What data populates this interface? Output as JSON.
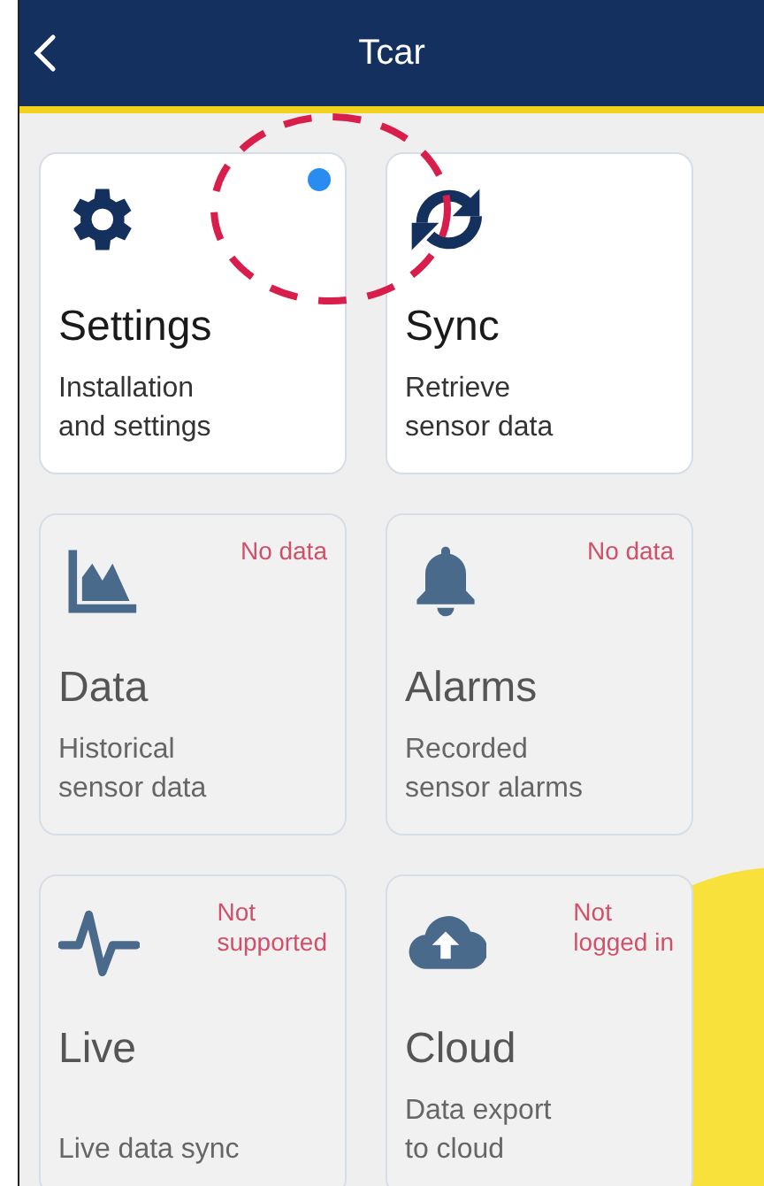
{
  "header": {
    "title": "Tcar"
  },
  "cards": [
    {
      "kind": "settings",
      "title": "Settings",
      "description": "Installation\nand settings",
      "disabled": false,
      "notification": true,
      "highlighted": true
    },
    {
      "kind": "sync",
      "title": "Sync",
      "description": "Retrieve\nsensor data",
      "disabled": false,
      "notification": false,
      "highlighted": false
    },
    {
      "kind": "data",
      "title": "Data",
      "description": "Historical\nsensor data",
      "status": "No data",
      "disabled": true,
      "notification": false,
      "highlighted": false
    },
    {
      "kind": "alarms",
      "title": "Alarms",
      "description": "Recorded\nsensor alarms",
      "status": "No data",
      "disabled": true,
      "notification": false,
      "highlighted": false
    },
    {
      "kind": "live",
      "title": "Live",
      "description": "Live data sync",
      "status": "Not\nsupported",
      "disabled": true,
      "notification": false,
      "highlighted": false
    },
    {
      "kind": "cloud",
      "title": "Cloud",
      "description": "Data export\nto cloud",
      "status": "Not\nlogged in",
      "disabled": true,
      "notification": false,
      "highlighted": false
    }
  ]
}
